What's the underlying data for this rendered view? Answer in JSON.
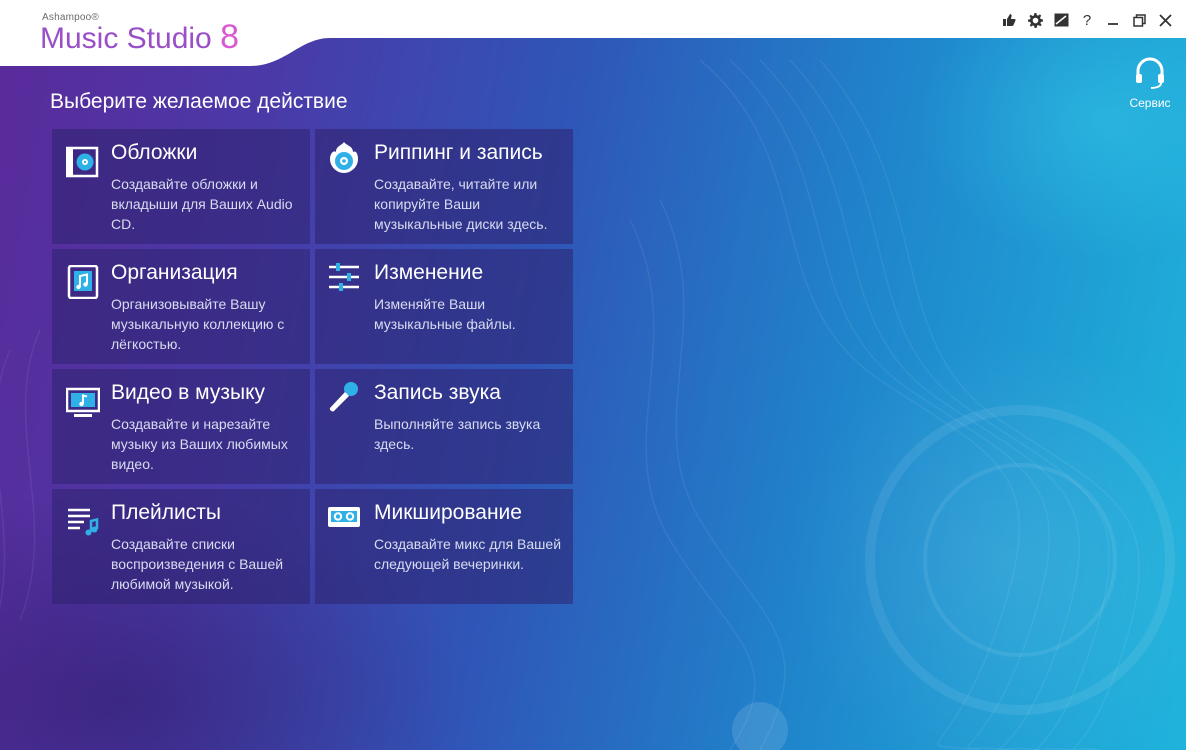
{
  "app": {
    "brand_small": "Ashampoo®",
    "brand_name": "Music Studio",
    "brand_version": "8"
  },
  "window_controls": [
    {
      "name": "like-icon"
    },
    {
      "name": "gear-icon"
    },
    {
      "name": "skin-icon"
    },
    {
      "name": "help-icon",
      "glyph": "?"
    },
    {
      "name": "minimize-icon"
    },
    {
      "name": "restore-icon"
    },
    {
      "name": "close-icon"
    }
  ],
  "service": {
    "label": "Сервис",
    "icon": "headset-icon"
  },
  "page_title": "Выберите желаемое действие",
  "tiles": [
    {
      "title": "Обложки",
      "desc": "Создавайте обложки и вкладыши для Ваших Audio CD.",
      "icon": "cover-icon"
    },
    {
      "title": "Риппинг и запись",
      "desc": "Создавайте, читайте или копируйте Ваши музыкальные диски здесь.",
      "icon": "disc-burn-icon"
    },
    {
      "title": "Организация",
      "desc": "Организовывайте Вашу музыкальную коллекцию с лёгкостью.",
      "icon": "music-file-icon"
    },
    {
      "title": "Изменение",
      "desc": "Изменяйте Ваши музыкальные файлы.",
      "icon": "sliders-icon"
    },
    {
      "title": "Видео в музыку",
      "desc": "Создавайте и нарезайте музыку из Ваших любимых видео.",
      "icon": "video-music-icon"
    },
    {
      "title": "Запись звука",
      "desc": "Выполняйте запись звука здесь.",
      "icon": "microphone-icon"
    },
    {
      "title": "Плейлисты",
      "desc": "Создавайте списки воспроизведения с Вашей любимой музыкой.",
      "icon": "playlist-icon"
    },
    {
      "title": "Микширование",
      "desc": "Создавайте микс для Вашей следующей вечеринки.",
      "icon": "cassette-icon"
    }
  ],
  "colors": {
    "accent_cyan": "#1fb4dc",
    "brand_purple": "#9a4fc8",
    "tile_bg": "#2d236e"
  }
}
